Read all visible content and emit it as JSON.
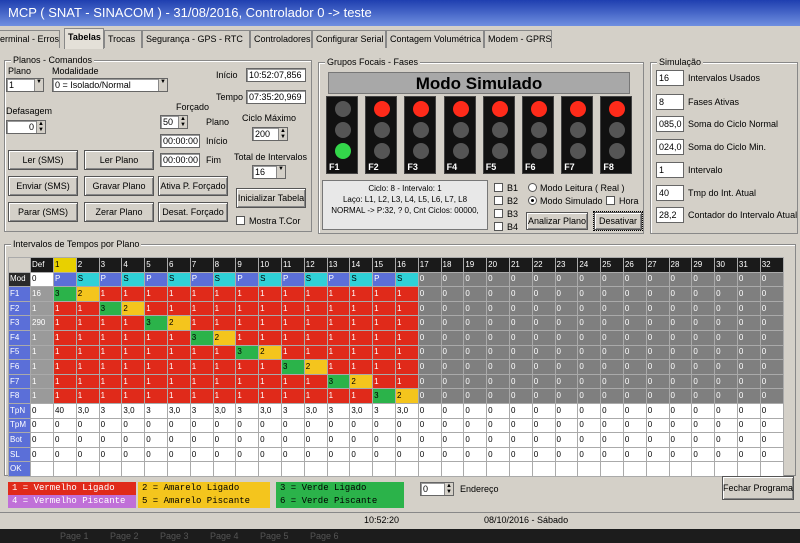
{
  "window": {
    "title": "MCP ( SNAT - SINACOM ) - 31/08/2016, Controlador 0 -> teste"
  },
  "tabs": [
    "erminal - Erros",
    "Tabelas",
    "Trocas",
    "Segurança - GPS - RTC",
    "Controladores",
    "Configurar Serial",
    "Contagem Volumétrica",
    "Modem - GPRS"
  ],
  "planos": {
    "group_title": "Planos - Comandos",
    "plano_label": "Plano",
    "plano_value": "1",
    "modalidade_label": "Modalidade",
    "modalidade_value": "0 = Isolado/Normal",
    "inicio_label": "Início",
    "inicio_value": "10:52:07,856",
    "tempo_label": "Tempo",
    "tempo_value": "07:35:20,969",
    "defasagem_label": "Defasagem",
    "defasagem_value": "0",
    "forcado_label": "Forçado",
    "forcado_value": "50",
    "forcado_plano_label": "Plano",
    "forcado_inicio_value": "00:00:00",
    "forcado_inicio_label": "Início",
    "forcado_fim_value": "00:00:00",
    "forcado_fim_label": "Fim",
    "ciclo_max_label": "Ciclo Máximo",
    "ciclo_max_value": "200",
    "total_intervalos_label": "Total de Intervalos",
    "total_intervalos_value": "16",
    "buttons": {
      "ler_sms": "Ler (SMS)",
      "ler_plano": "Ler Plano",
      "enviar_sms": "Enviar (SMS)",
      "gravar_plano": "Gravar Plano",
      "ativa_forcado": "Ativa P. Forçado",
      "parar_sms": "Parar (SMS)",
      "zerar_plano": "Zerar Plano",
      "desat_forcado": "Desat. Forçado",
      "inicializar_tabela": "Inicializar Tabela"
    },
    "mostra_tcor": "Mostra T.Cor"
  },
  "grupos": {
    "group_title": "Grupos Focais - Fases",
    "header": "Modo Simulado",
    "faces": [
      {
        "id": "F1",
        "state": "green"
      },
      {
        "id": "F2",
        "state": "red"
      },
      {
        "id": "F3",
        "state": "red"
      },
      {
        "id": "F4",
        "state": "red"
      },
      {
        "id": "F5",
        "state": "red"
      },
      {
        "id": "F6",
        "state": "red"
      },
      {
        "id": "F7",
        "state": "red"
      },
      {
        "id": "F8",
        "state": "red"
      }
    ],
    "info_line1": "Ciclo: 8 - Intervalo: 1",
    "info_line2": "Laço: L1, L2, L3, L4, L5, L6, L7, L8",
    "info_line3": "NORMAL -> P:32, ? 0, Cnt Ciclos: 00000,",
    "b_labels": [
      "B1",
      "B2",
      "B3",
      "B4"
    ],
    "modo_leitura": "Modo Leitura ( Real )",
    "modo_simulado": "Modo Simulado",
    "hora": "Hora",
    "analizar_plano": "Analizar Plano",
    "desativar": "Desativar"
  },
  "simulacao": {
    "group_title": "Simulação",
    "rows": [
      {
        "value": "16",
        "label": "Intervalos Usados"
      },
      {
        "value": "8",
        "label": "Fases Ativas"
      },
      {
        "value": "085,0",
        "label": "Soma do Ciclo Normal"
      },
      {
        "value": "024,0",
        "label": "Soma do Ciclo Min."
      },
      {
        "value": "1",
        "label": "Intervalo"
      },
      {
        "value": "40",
        "label": "Tmp do Int. Atual"
      },
      {
        "value": "28,2",
        "label": "Contador do Intervalo Atual"
      }
    ]
  },
  "table": {
    "group_title": "Intervalos de Tempos por Plano",
    "header": [
      "",
      "Def",
      "1",
      "2",
      "3",
      "4",
      "5",
      "6",
      "7",
      "8",
      "9",
      "10",
      "11",
      "12",
      "13",
      "14",
      "15",
      "16",
      "17",
      "18",
      "19",
      "20",
      "21",
      "22",
      "23",
      "24",
      "25",
      "26",
      "27",
      "28",
      "29",
      "30",
      "31",
      "32"
    ],
    "mod_row": [
      "Mod",
      "0",
      "P",
      "S",
      "P",
      "S",
      "P",
      "S",
      "P",
      "S",
      "P",
      "S",
      "P",
      "S",
      "P",
      "S",
      "P",
      "S",
      "0",
      "0",
      "0",
      "0",
      "0",
      "0",
      "0",
      "0",
      "0",
      "0",
      "0",
      "0",
      "0",
      "0",
      "0",
      "0"
    ],
    "phase_rows": [
      {
        "label": "F1",
        "def": "16",
        "cells": [
          "3",
          "2",
          "1",
          "1",
          "1",
          "1",
          "1",
          "1",
          "1",
          "1",
          "1",
          "1",
          "1",
          "1",
          "1",
          "1"
        ]
      },
      {
        "label": "F2",
        "def": "1",
        "cells": [
          "1",
          "1",
          "3",
          "2",
          "1",
          "1",
          "1",
          "1",
          "1",
          "1",
          "1",
          "1",
          "1",
          "1",
          "1",
          "1"
        ]
      },
      {
        "label": "F3",
        "def": "290",
        "cells": [
          "1",
          "1",
          "1",
          "1",
          "3",
          "2",
          "1",
          "1",
          "1",
          "1",
          "1",
          "1",
          "1",
          "1",
          "1",
          "1"
        ]
      },
      {
        "label": "F4",
        "def": "1",
        "cells": [
          "1",
          "1",
          "1",
          "1",
          "1",
          "1",
          "3",
          "2",
          "1",
          "1",
          "1",
          "1",
          "1",
          "1",
          "1",
          "1"
        ]
      },
      {
        "label": "F5",
        "def": "1",
        "cells": [
          "1",
          "1",
          "1",
          "1",
          "1",
          "1",
          "1",
          "1",
          "3",
          "2",
          "1",
          "1",
          "1",
          "1",
          "1",
          "1"
        ]
      },
      {
        "label": "F6",
        "def": "1",
        "cells": [
          "1",
          "1",
          "1",
          "1",
          "1",
          "1",
          "1",
          "1",
          "1",
          "1",
          "3",
          "2",
          "1",
          "1",
          "1",
          "1"
        ]
      },
      {
        "label": "F7",
        "def": "1",
        "cells": [
          "1",
          "1",
          "1",
          "1",
          "1",
          "1",
          "1",
          "1",
          "1",
          "1",
          "1",
          "1",
          "3",
          "2",
          "1",
          "1"
        ]
      },
      {
        "label": "F8",
        "def": "1",
        "cells": [
          "1",
          "1",
          "1",
          "1",
          "1",
          "1",
          "1",
          "1",
          "1",
          "1",
          "1",
          "1",
          "1",
          "1",
          "3",
          "2"
        ]
      }
    ],
    "tpn_row": [
      "TpN",
      "0",
      "40",
      "3,0",
      "3",
      "3,0",
      "3",
      "3,0",
      "3",
      "3,0",
      "3",
      "3,0",
      "3",
      "3,0",
      "3",
      "3,0",
      "3",
      "3,0",
      "0",
      "0",
      "0",
      "0",
      "0",
      "0",
      "0",
      "0",
      "0",
      "0",
      "0",
      "0",
      "0",
      "0",
      "0",
      "0"
    ],
    "zero_rows": [
      "TpM",
      "Bot",
      "SL",
      "OK"
    ]
  },
  "legend": [
    "1 = Vermelho Ligado",
    "2 = Amarelo Ligado",
    "3 = Verde Ligado",
    "4 = Vermelho Piscante",
    "5 = Amarelo Piscante",
    "6 = Verde Piscante"
  ],
  "endereco_label": "Endereço",
  "endereco_value": "0",
  "fechar": "Fechar Programa",
  "status": {
    "time": "10:52:20",
    "date": "08/10/2016 - Sábado"
  },
  "pages": [
    "Page 1",
    "Page 2",
    "Page 3",
    "Page 4",
    "Page 5",
    "Page 6"
  ],
  "colors": {
    "red": "#e02a1a",
    "yellow": "#f4c51d",
    "green": "#2bb34a",
    "cyan": "#2fd1d7",
    "purple": "#5b6fd8",
    "dark": "#7f7f7f",
    "lamp_red": "#ff2b1a",
    "lamp_green": "#33d64a"
  }
}
